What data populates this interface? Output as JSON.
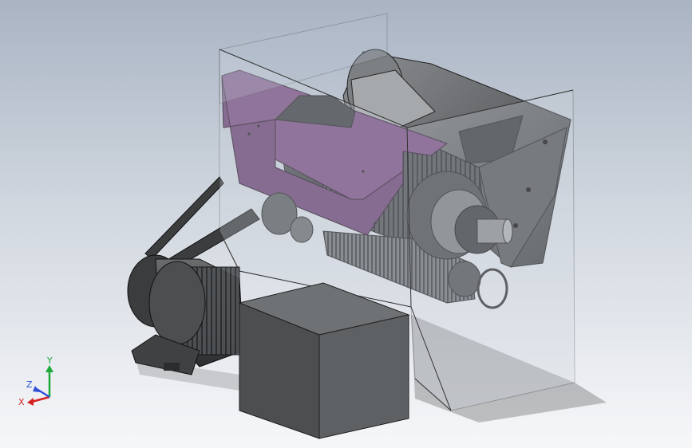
{
  "viewport": {
    "background_top": "#a9b4c3",
    "background_bottom": "#f6f7f9"
  },
  "model": {
    "housing_color": "#9aa3ab",
    "guard_color": "#7a4f82",
    "metal_color": "#6e7174",
    "motor_color": "#4a4c4e",
    "gearbox_color": "#5a5c5e"
  },
  "triad": {
    "y_label": "Y",
    "z_label": "Z",
    "x_label": "X",
    "y_color": "#1fa83a",
    "x_color": "#d62020",
    "z_color": "#3050d8"
  }
}
